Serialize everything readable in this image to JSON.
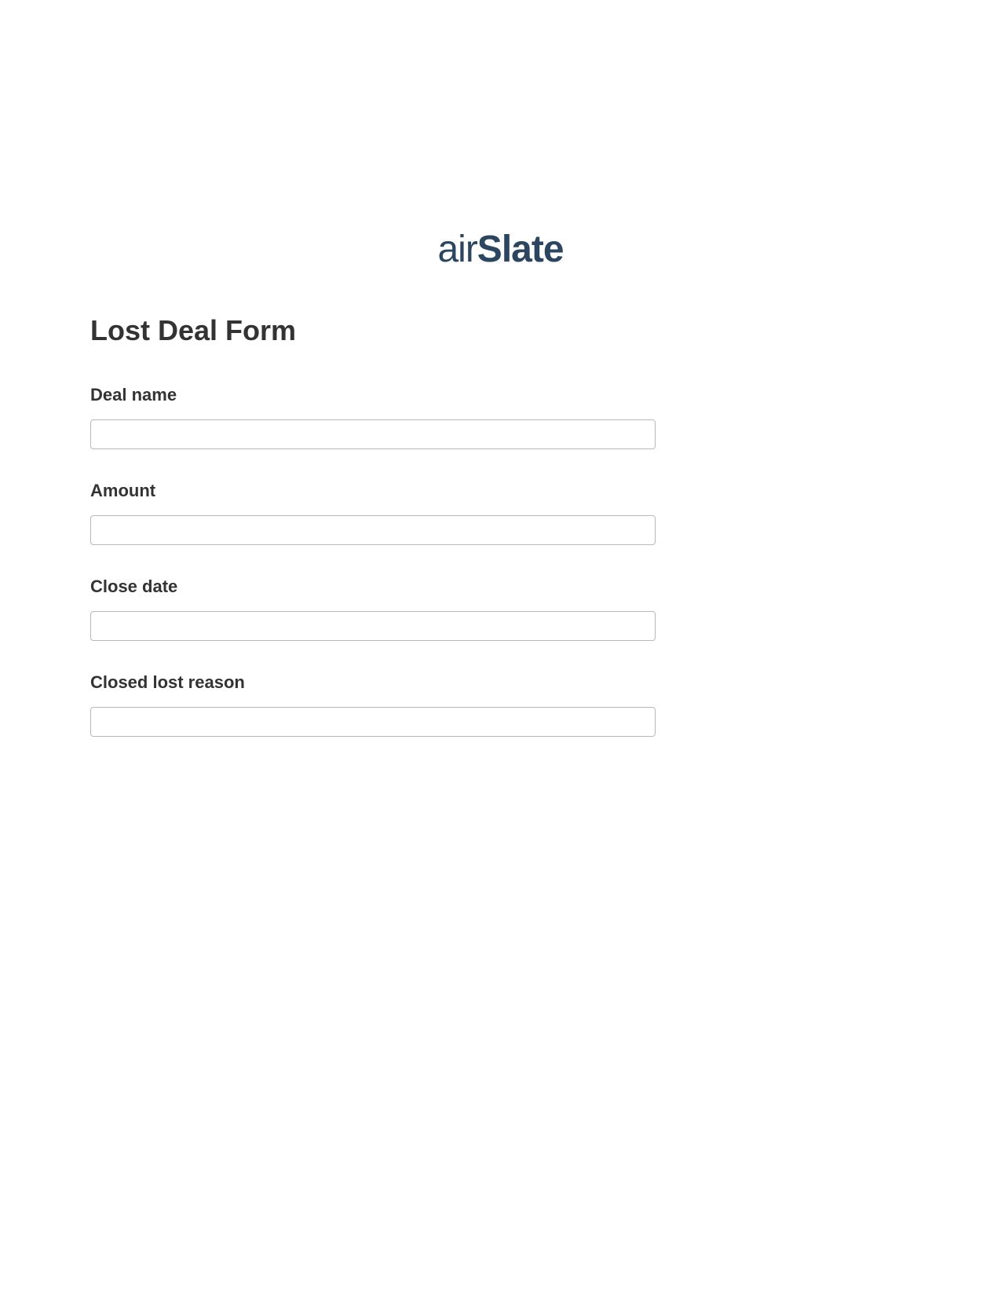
{
  "logo": {
    "prefix": "air",
    "suffix": "Slate"
  },
  "form": {
    "title": "Lost Deal Form",
    "fields": [
      {
        "label": "Deal name",
        "value": ""
      },
      {
        "label": "Amount",
        "value": ""
      },
      {
        "label": "Close date",
        "value": ""
      },
      {
        "label": "Closed lost reason",
        "value": ""
      }
    ]
  }
}
